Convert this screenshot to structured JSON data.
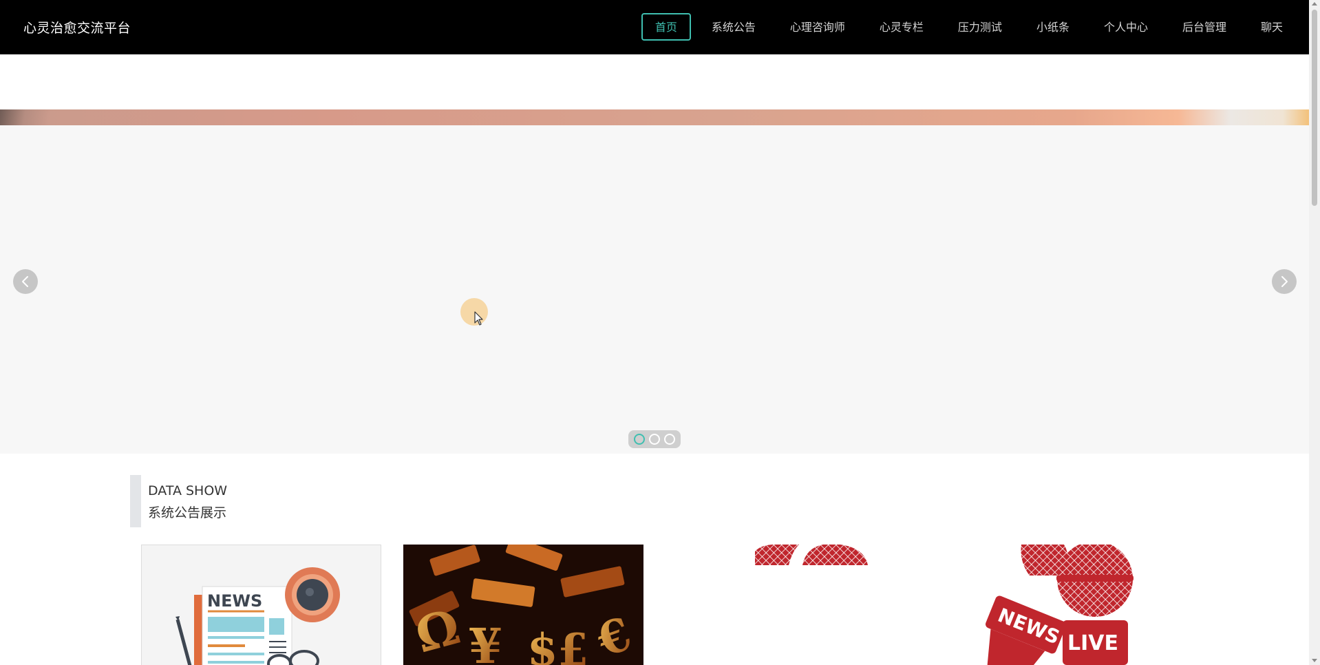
{
  "header": {
    "brand": "心灵治愈交流平台",
    "nav": [
      {
        "label": "首页",
        "active": true
      },
      {
        "label": "系统公告"
      },
      {
        "label": "心理咨询师"
      },
      {
        "label": "心灵专栏"
      },
      {
        "label": "压力测试"
      },
      {
        "label": "小纸条"
      },
      {
        "label": "个人中心"
      },
      {
        "label": "后台管理"
      },
      {
        "label": "聊天"
      }
    ]
  },
  "carousel": {
    "slide_count": 3,
    "active_index": 0,
    "prev_icon": "chevron-left-icon",
    "next_icon": "chevron-right-icon"
  },
  "section": {
    "title_en": "DATA SHOW",
    "title_cn": "系统公告展示"
  },
  "cards": [
    {
      "image": "news-illustration-image",
      "text": "NEWS"
    },
    {
      "image": "currency-symbols-image"
    },
    {
      "image": "microphone-partial-image"
    },
    {
      "image": "news-live-microphone-image",
      "text_top": "NEWS",
      "text_bottom": "LIVE"
    }
  ],
  "colors": {
    "accent": "#3fbfb0",
    "topbar": "#000000",
    "carousel_bg": "#f7f7f7",
    "news_red": "#c0262d"
  }
}
